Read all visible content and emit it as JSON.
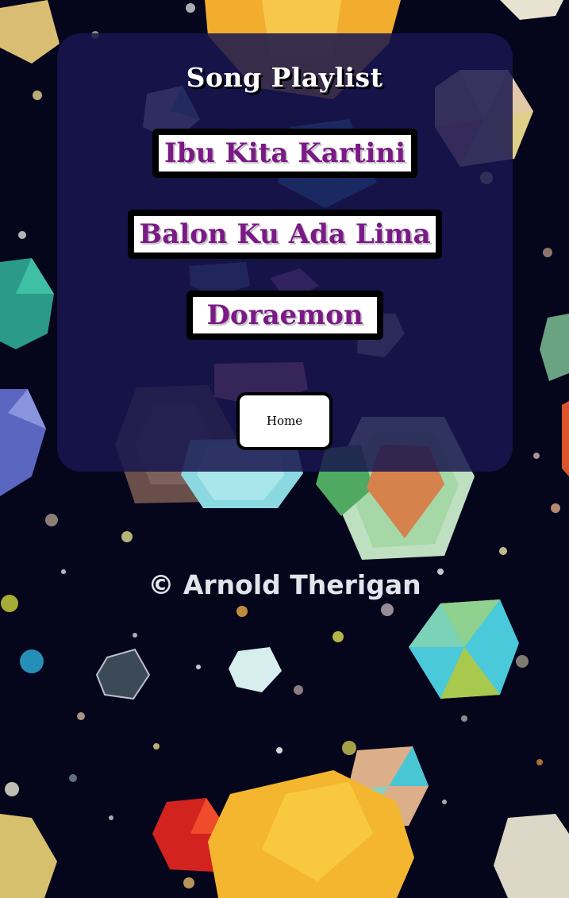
{
  "page": {
    "title": "Song Playlist",
    "copyright": "© Arnold Therigan"
  },
  "songs": [
    {
      "label": "Ibu Kita Kartini"
    },
    {
      "label": "Balon Ku Ada Lima"
    },
    {
      "label": "Doraemon"
    }
  ],
  "nav": {
    "home_label": "Home"
  },
  "colors": {
    "background": "#05051c",
    "panel": "#18164e",
    "song_text": "#7b1a86",
    "button_bg": "#ffffff",
    "button_border": "#000000"
  }
}
